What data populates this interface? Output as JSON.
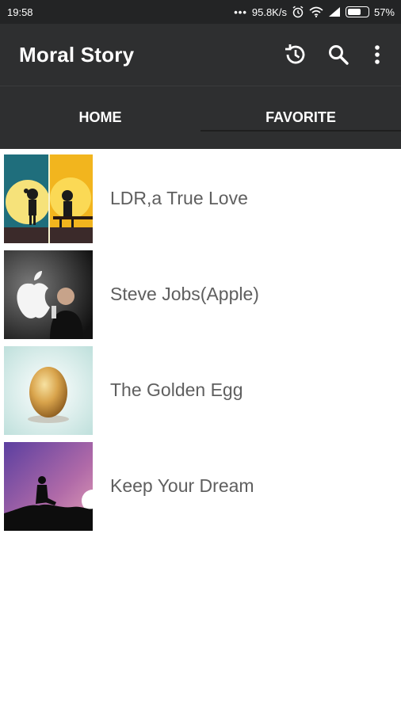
{
  "status_bar": {
    "time": "19:58",
    "network_speed": "95.8K/s",
    "battery": "57%",
    "battery_level_percent": 57
  },
  "app_bar": {
    "title": "Moral Story",
    "actions": [
      "history-icon",
      "search-icon",
      "more-vert-icon"
    ]
  },
  "tabs": [
    {
      "label": "HOME",
      "selected": true
    },
    {
      "label": "FAVORITE",
      "selected": false
    }
  ],
  "stories": [
    {
      "title": "LDR,a True Love",
      "thumbnail": "couple-silhouette-image"
    },
    {
      "title": "Steve Jobs(Apple)",
      "thumbnail": "steve-jobs-apple-image"
    },
    {
      "title": "The Golden Egg",
      "thumbnail": "golden-egg-image"
    },
    {
      "title": "Keep Your Dream",
      "thumbnail": "dreamer-silhouette-image"
    }
  ],
  "colors": {
    "appbar": "#2e2f30",
    "statusbar": "#232425",
    "text": "#5f5f5f"
  }
}
